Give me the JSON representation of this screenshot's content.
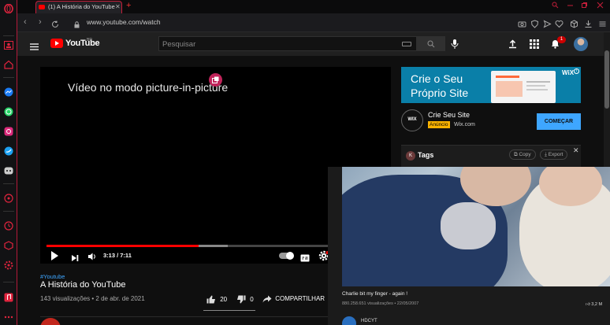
{
  "browser": {
    "tab_title": "(1) A História do YouTube",
    "url": "www.youtube.com/watch",
    "sidebar_icons": [
      "opera-logo-icon",
      "contacts-icon",
      "home-icon",
      "messenger-icon",
      "whatsapp-icon",
      "instagram-icon",
      "twitter-icon",
      "discord-icon",
      "player-icon",
      "history-icon",
      "extensions-icon",
      "settings-icon",
      "music-icon",
      "more-icon"
    ]
  },
  "youtube": {
    "brand": "YouTube",
    "region": "BR",
    "search_placeholder": "Pesquisar",
    "notification_count": "1",
    "player": {
      "pip_message": "Vídeo no modo picture-in-picture",
      "time": "3:13 / 7:11",
      "progress_fraction": 0.449
    },
    "video": {
      "hashtag": "#Youtube",
      "title": "A História do YouTube",
      "views": "143 visualizações • 2 de abr. de 2021",
      "likes": "20",
      "dislikes": "0",
      "share_label": "COMPARTILHAR"
    },
    "ad": {
      "headline": "Crie o Seu Próprio Site",
      "brand_mini": "WiX",
      "logo_text": "WIX",
      "title": "Crie Seu Site",
      "tag": "Anúncio",
      "domain": "Wix.com",
      "cta": "COMEÇAR"
    },
    "tags_panel": {
      "avatar_letter": "K",
      "title": "Tags",
      "copy_label": "Copy",
      "export_label": "Export"
    }
  },
  "pip_window": {
    "title": "Charlie bit my finger - again !",
    "meta": "880.258.651 visualizações • 22/05/2007",
    "likes": "3,2 M",
    "channel_name": "HDCYT"
  },
  "colors": {
    "accent": "#ff0000",
    "opera_red": "#c41e3a",
    "link_blue": "#3ea6ff",
    "ad_blue": "#0a7fa8"
  }
}
